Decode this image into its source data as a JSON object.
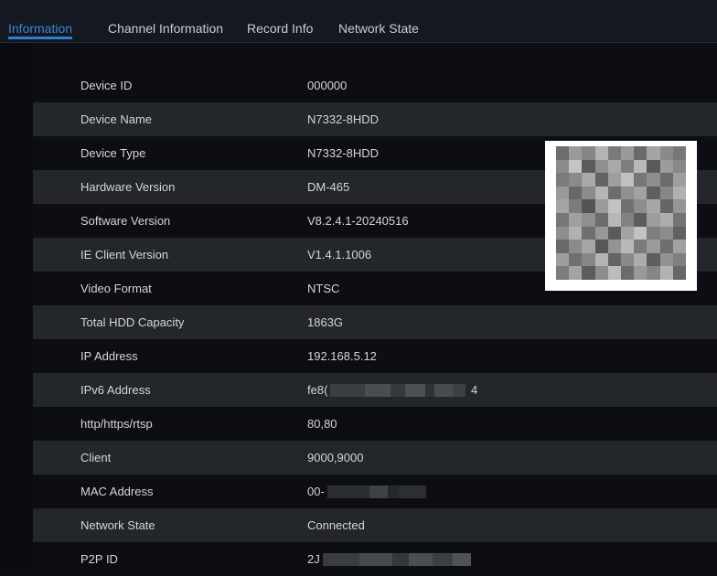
{
  "tabs": [
    {
      "label": "Information",
      "active": true
    },
    {
      "label": "Channel Information",
      "active": false
    },
    {
      "label": "Record Info",
      "active": false
    },
    {
      "label": "Network State",
      "active": false
    }
  ],
  "info_rows": [
    {
      "label": "Device ID",
      "value": "000000"
    },
    {
      "label": "Device Name",
      "value": "N7332-8HDD"
    },
    {
      "label": "Device Type",
      "value": "N7332-8HDD"
    },
    {
      "label": "Hardware Version",
      "value": "DM-465"
    },
    {
      "label": "Software Version",
      "value": "V8.2.4.1-20240516"
    },
    {
      "label": "IE Client Version",
      "value": "V1.4.1.1006"
    },
    {
      "label": "Video Format",
      "value": "NTSC"
    },
    {
      "label": "Total HDD Capacity",
      "value": "1863G"
    },
    {
      "label": "IP Address",
      "value": "192.168.5.12"
    },
    {
      "label": "IPv6 Address",
      "value": "fe8(",
      "value_suffix": "4"
    },
    {
      "label": "http/https/rtsp",
      "value": "80,80"
    },
    {
      "label": "Client",
      "value": "9000,9000"
    },
    {
      "label": "MAC Address",
      "value": "00-"
    },
    {
      "label": "Network State",
      "value": "Connected"
    },
    {
      "label": "P2P ID",
      "value": "2J"
    }
  ],
  "colors": {
    "accent": "#2f7dd6",
    "background": "#0c0e13",
    "row_alt": "#23262b"
  }
}
